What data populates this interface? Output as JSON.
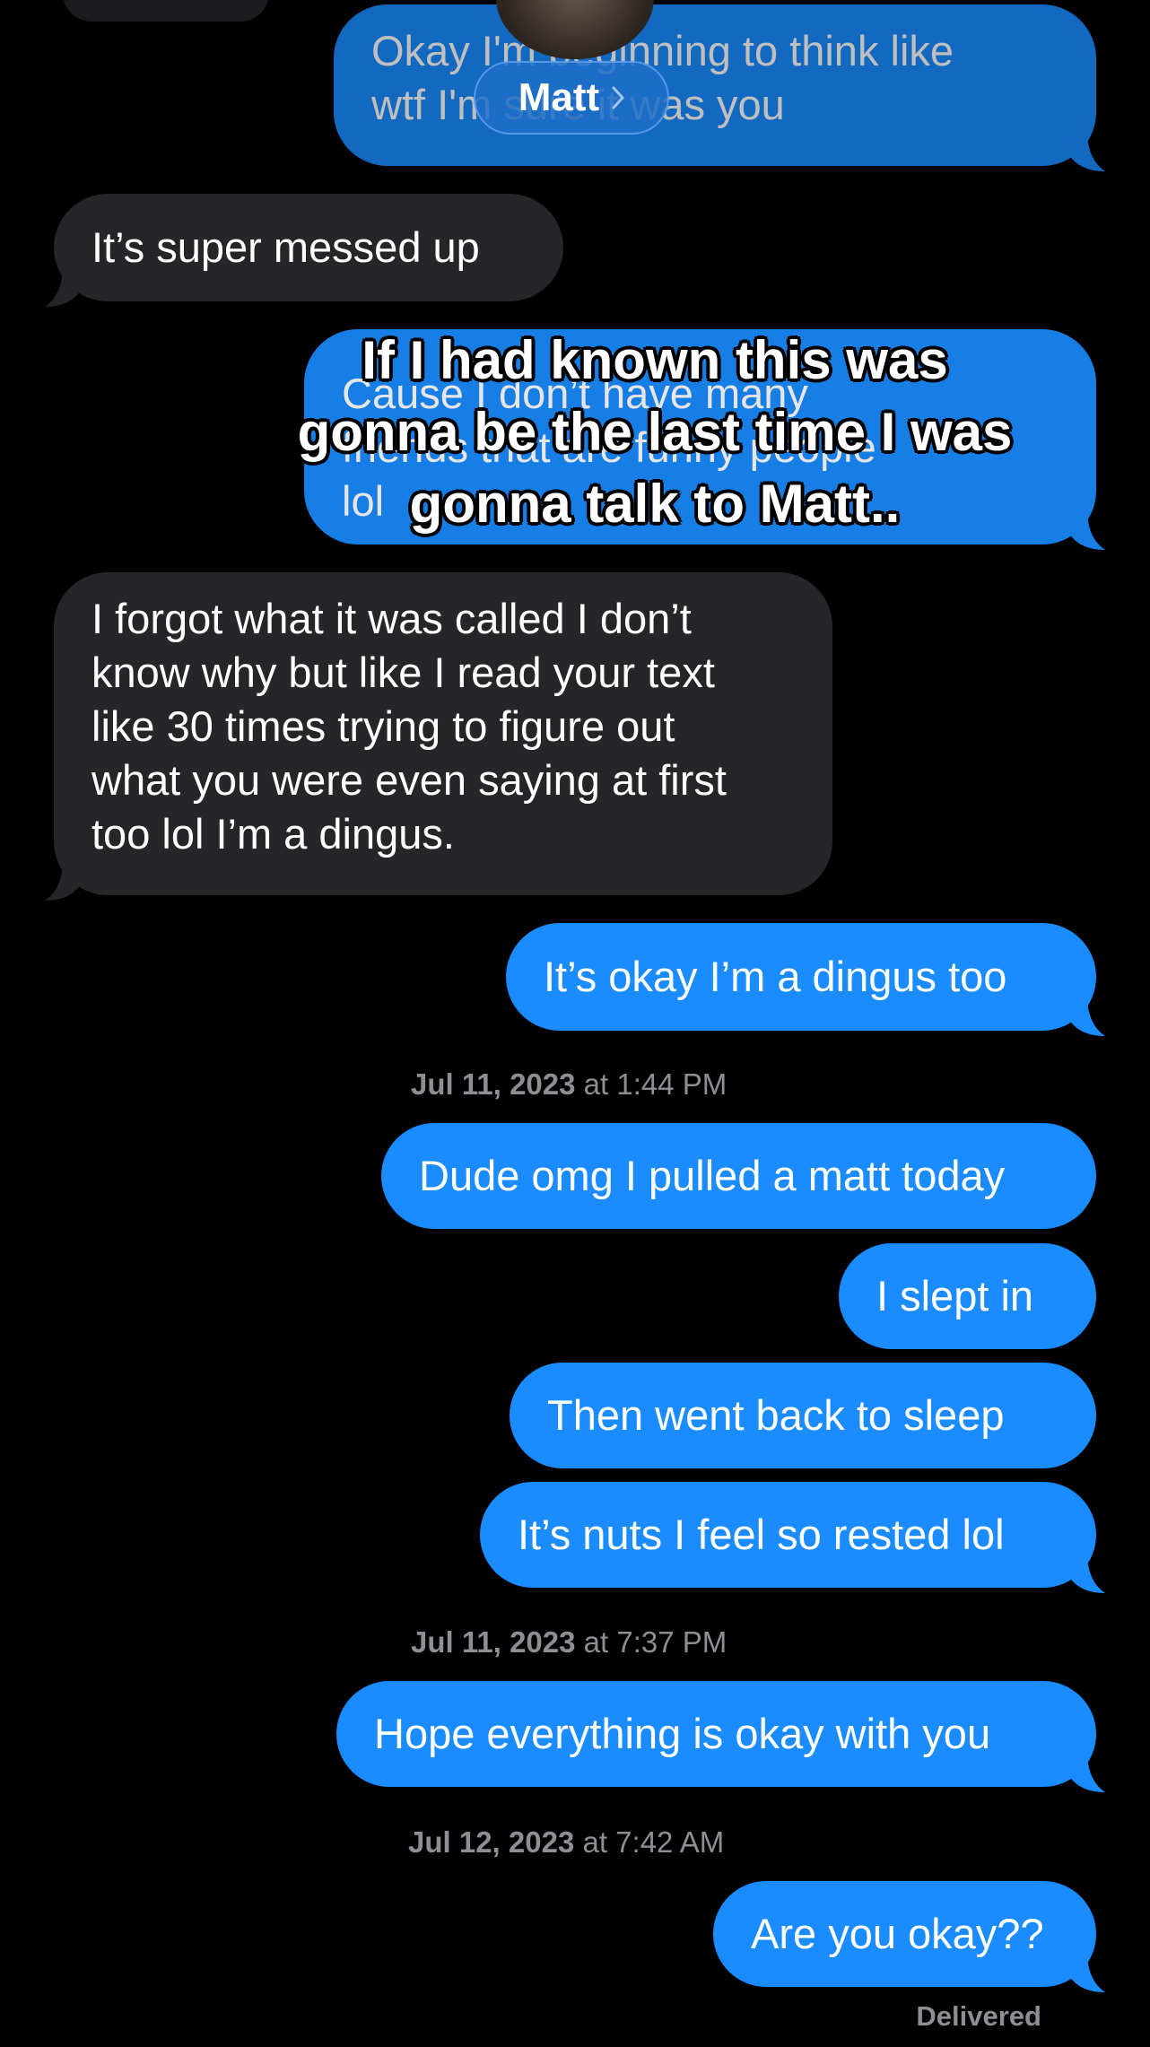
{
  "header": {
    "contact_name": "Matt"
  },
  "messages": [
    {
      "id": "m1",
      "dir": "out",
      "text": "Okay I'm beginning to think like\nwtf I'm sure it was you"
    },
    {
      "id": "m2",
      "dir": "in",
      "text": "It’s super messed up"
    },
    {
      "id": "m3",
      "dir": "out",
      "text": "Cause I don’t have many\nfriends that are funny people\nlol"
    },
    {
      "id": "m4",
      "dir": "in",
      "text": "I forgot what it was called I don’t\nknow why but like I read your text\nlike 30 times trying to figure out\nwhat you were even saying at first\ntoo lol I’m a dingus."
    },
    {
      "id": "m5",
      "dir": "out",
      "text": "It’s okay I’m a dingus too"
    },
    {
      "id": "m6",
      "dir": "out",
      "text": "Dude omg I pulled a matt today"
    },
    {
      "id": "m7",
      "dir": "out",
      "text": "I slept in"
    },
    {
      "id": "m8",
      "dir": "out",
      "text": "Then went back to sleep"
    },
    {
      "id": "m9",
      "dir": "out",
      "text": "It’s nuts I feel so rested lol"
    },
    {
      "id": "m10",
      "dir": "out",
      "text": "Hope everything is okay with you"
    },
    {
      "id": "m11",
      "dir": "out",
      "text": "Are you okay??"
    }
  ],
  "timestamps": [
    {
      "date": "Jul 11, 2023",
      "time": "at 1:44 PM"
    },
    {
      "date": "Jul 11, 2023",
      "time": "at 7:37 PM"
    },
    {
      "date": "Jul 12, 2023",
      "time": "at 7:42 AM"
    }
  ],
  "status": {
    "delivered": "Delivered"
  },
  "overlay_caption": "If I had known this was\ngonna be the last time I was\ngonna talk to Matt..",
  "colors": {
    "outgoing_bubble": "#1a8cff",
    "incoming_bubble": "#262628",
    "background": "#000000",
    "timestamp": "#8e8e93"
  },
  "icons": [
    "chevron-right-icon",
    "avatar"
  ]
}
